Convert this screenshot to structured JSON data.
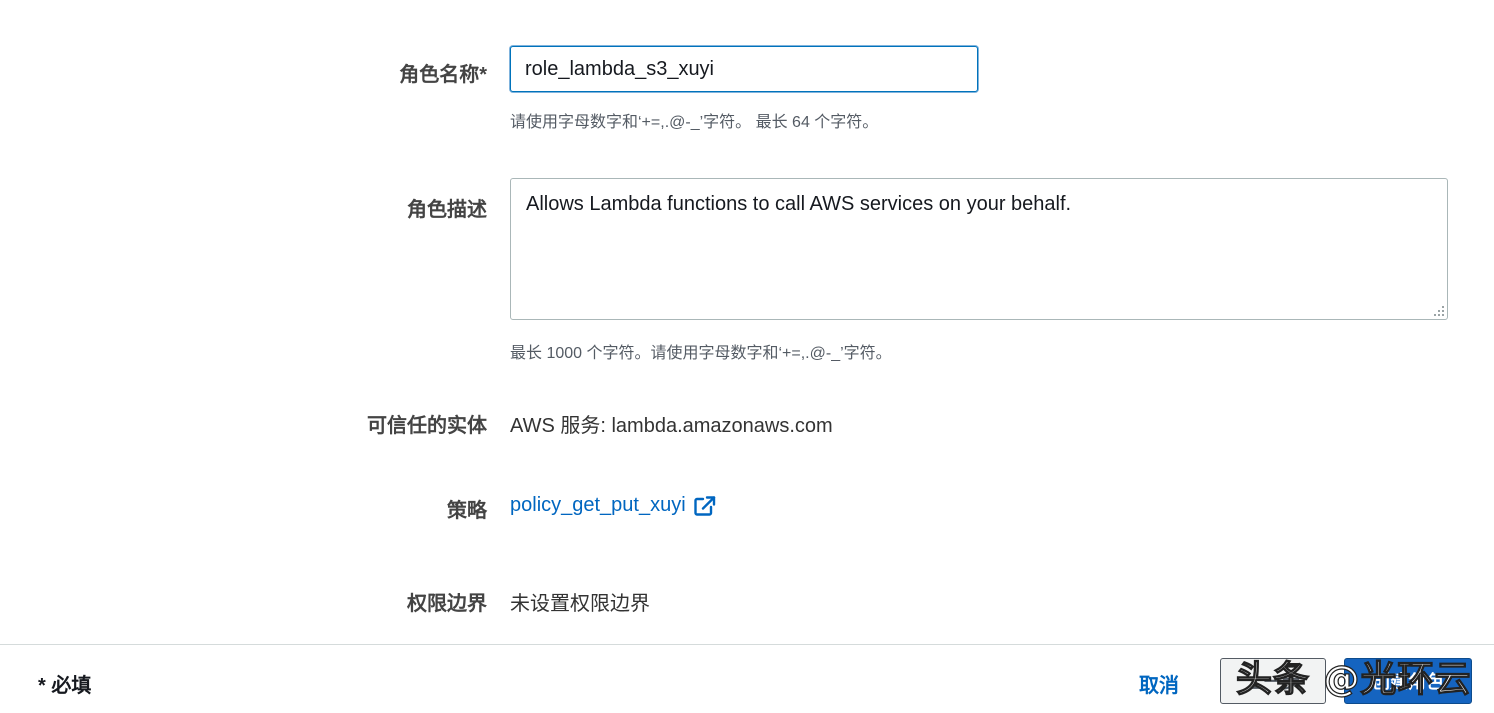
{
  "form": {
    "role_name": {
      "label": "角色名称*",
      "value": "role_lambda_s3_xuyi",
      "hint": "请使用字母数字和‘+=,.@-_’字符。 最长 64 个字符。"
    },
    "role_description": {
      "label": "角色描述",
      "value": "Allows Lambda functions to call AWS services on your behalf.",
      "hint": "最长 1000 个字符。请使用字母数字和‘+=,.@-_’字符。"
    },
    "trusted_entity": {
      "label": "可信任的实体",
      "value": "AWS 服务: lambda.amazonaws.com"
    },
    "policy": {
      "label": "策略",
      "link_text": "policy_get_put_xuyi",
      "icon": "external-link-icon"
    },
    "permission_boundary": {
      "label": "权限边界",
      "value": "未设置权限边界"
    }
  },
  "footer": {
    "required_note": "* 必填",
    "cancel_label": "取消",
    "previous_label": "上一步",
    "create_label": "创建角色"
  },
  "watermark": "头条 @光环云",
  "colors": {
    "link": "#0066c0",
    "focus_border": "#0073bb",
    "primary_button": "#1564c0"
  }
}
